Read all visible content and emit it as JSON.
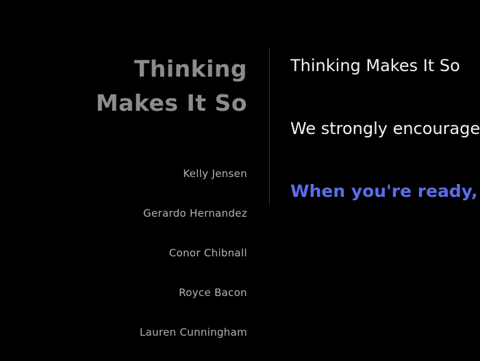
{
  "sidebar": {
    "title_line1": "Thinking",
    "title_line2": "Makes It So",
    "names": [
      "Kelly Jensen",
      "Gerardo Hernandez",
      "Conor Chibnall",
      "Royce Bacon",
      "Lauren Cunningham"
    ]
  },
  "main": {
    "heading": "Thinking Makes It So",
    "paragraph": "We strongly encourage y",
    "cta": "When you're ready, you"
  },
  "colors": {
    "background": "#000000",
    "title": "#8c8c8c",
    "names": "#b4b4b4",
    "text": "#f2f2f2",
    "accent": "#5b6ee8"
  }
}
